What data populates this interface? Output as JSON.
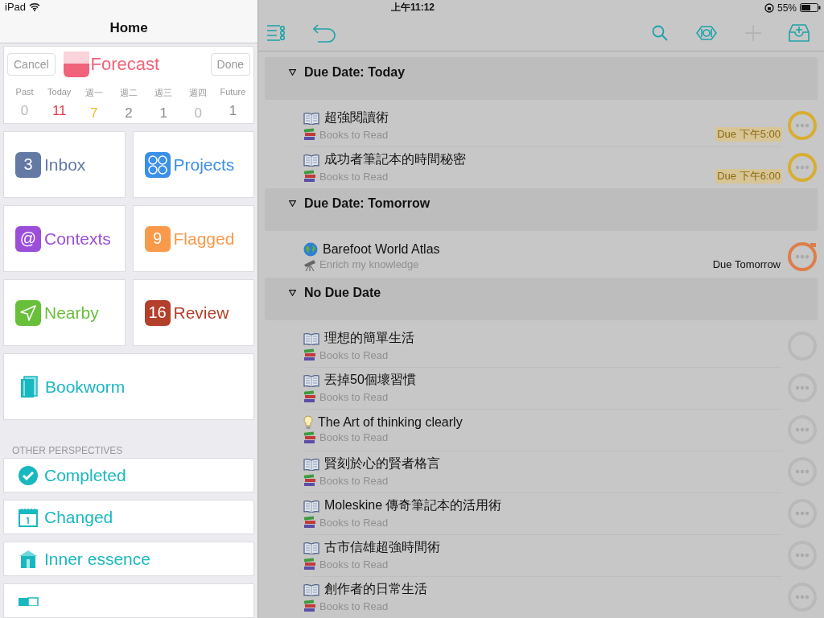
{
  "status_bar": {
    "device": "iPad",
    "time": "上午11:12",
    "battery": "55%"
  },
  "sidebar": {
    "title": "Home",
    "cancel": "Cancel",
    "done": "Done",
    "forecast": {
      "label": "Forecast",
      "days": [
        {
          "label": "Past",
          "count": "0",
          "color": "#b8b8bc"
        },
        {
          "label": "Today",
          "count": "11",
          "color": "#e8384f"
        },
        {
          "label": "週一",
          "count": "7",
          "color": "#f5b82e"
        },
        {
          "label": "週二",
          "count": "2",
          "color": "#8a8a8a"
        },
        {
          "label": "週三",
          "count": "1",
          "color": "#8a8a8a"
        },
        {
          "label": "週四",
          "count": "0",
          "color": "#b8b8bc"
        },
        {
          "label": "Future",
          "count": "1",
          "color": "#8a8a8a"
        }
      ]
    },
    "tiles": [
      {
        "kind": "count",
        "badge": "3",
        "label": "Inbox",
        "color": "#6479a3"
      },
      {
        "kind": "projects",
        "label": "Projects",
        "color": "#3a8fe8"
      },
      {
        "kind": "at",
        "badge": "@",
        "label": "Contexts",
        "color": "#9b4fd9"
      },
      {
        "kind": "count",
        "badge": "9",
        "label": "Flagged",
        "color": "#f99a4a"
      },
      {
        "kind": "nearby",
        "label": "Nearby",
        "color": "#68bf3a"
      },
      {
        "kind": "count",
        "badge": "16",
        "label": "Review",
        "color": "#b3402a"
      }
    ],
    "bookworm": {
      "label": "Bookworm"
    },
    "other_header": "OTHER PERSPECTIVES",
    "perspectives": [
      {
        "kind": "check",
        "label": "Completed"
      },
      {
        "kind": "calendar",
        "label": "Changed"
      },
      {
        "kind": "house",
        "label": "Inner essence"
      },
      {
        "kind": "folder"
      }
    ]
  },
  "groups": [
    {
      "title": "Due Date: Today",
      "tasks": [
        {
          "kind": "book",
          "title": "超強閱讀術",
          "project": {
            "kind": "books",
            "label": "Books to Read"
          },
          "due": "Due 下午5:00",
          "due_soon": true,
          "color": "#d9ad32",
          "notes": true,
          "flagged": false
        },
        {
          "kind": "book",
          "title": "成功者筆記本的時間秘密",
          "project": {
            "kind": "books",
            "label": "Books to Read"
          },
          "due": "Due 下午6:00",
          "due_soon": true,
          "color": "#d9ad32",
          "notes": true,
          "flagged": false
        }
      ]
    },
    {
      "title": "Due Date: Tomorrow",
      "tasks": [
        {
          "kind": "globe",
          "title": "Barefoot World Atlas",
          "project": {
            "kind": "telescope",
            "label": "Enrich my knowledge"
          },
          "due": "Due Tomorrow",
          "due_soon": false,
          "color": "#de7e4a",
          "notes": true,
          "flagged": true
        }
      ]
    },
    {
      "title": "No Due Date",
      "tasks": [
        {
          "kind": "book",
          "title": "理想的簡單生活",
          "project": {
            "kind": "books",
            "label": "Books to Read"
          },
          "color": "#b9b9b9",
          "notes": false,
          "flagged": false
        },
        {
          "kind": "book",
          "title": "丟掉50個壞習慣",
          "project": {
            "kind": "books",
            "label": "Books to Read"
          },
          "color": "#b9b9b9",
          "notes": true,
          "flagged": false
        },
        {
          "kind": "bulb",
          "title": "The Art of thinking clearly",
          "project": {
            "kind": "books",
            "label": "Books to Read"
          },
          "color": "#b9b9b9",
          "notes": true,
          "flagged": false
        },
        {
          "kind": "book",
          "title": "賢刻於心的賢者格言",
          "project": {
            "kind": "books",
            "label": "Books to Read"
          },
          "color": "#b9b9b9",
          "notes": true,
          "flagged": false
        },
        {
          "kind": "book",
          "title": "Moleskine 傳奇筆記本的活用術",
          "project": {
            "kind": "books",
            "label": "Books to Read"
          },
          "color": "#b9b9b9",
          "notes": true,
          "flagged": false
        },
        {
          "kind": "book",
          "title": "古市信雄超強時間術",
          "project": {
            "kind": "books",
            "label": "Books to Read"
          },
          "color": "#b9b9b9",
          "notes": true,
          "flagged": false
        },
        {
          "kind": "book",
          "title": "創作者的日常生活",
          "project": {
            "kind": "books",
            "label": "Books to Read"
          },
          "color": "#b9b9b9",
          "notes": true,
          "flagged": false
        }
      ]
    }
  ]
}
